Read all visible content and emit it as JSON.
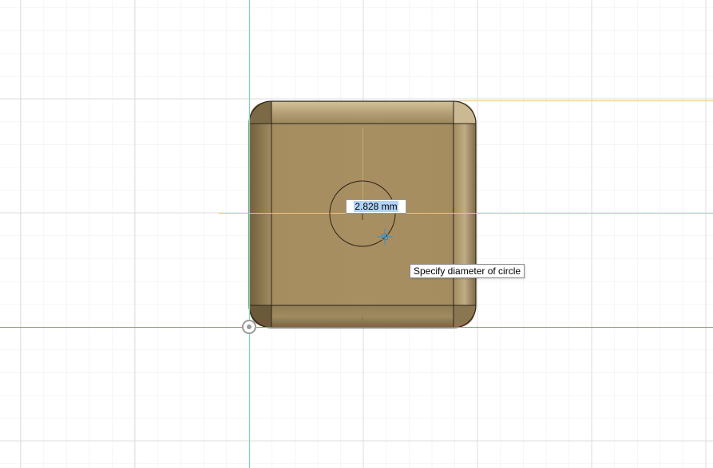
{
  "viewport": {
    "colors": {
      "background": "#ffffff",
      "grid_minor": "#ececec",
      "grid_major": "#dcdcdc",
      "axis_x": "#e06c6c",
      "axis_y": "#7fd6a8",
      "construction_line": "#f1c27a",
      "body_fill": "#a88f62",
      "body_edge": "#2b2418",
      "origin_marker": "#9a9a9a"
    },
    "icons": {
      "origin": "origin-icon",
      "cursor": "crosshair-cursor-icon"
    }
  },
  "dimension_input": {
    "value": "2.828 mm"
  },
  "tooltip": {
    "text": "Specify diameter of circle"
  }
}
